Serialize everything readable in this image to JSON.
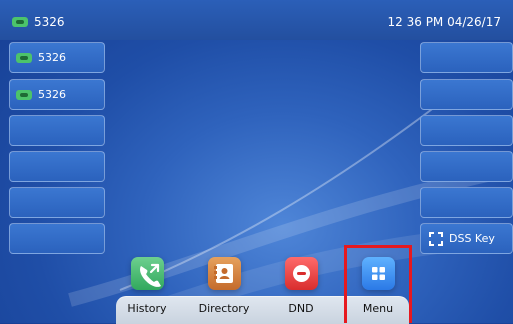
{
  "status": {
    "account": "5326",
    "datetime": "12 36 PM 04/26/17"
  },
  "left_keys": [
    {
      "label": "5326"
    },
    {
      "label": "5326"
    },
    {
      "label": ""
    },
    {
      "label": ""
    },
    {
      "label": ""
    },
    {
      "label": ""
    }
  ],
  "right_keys": [
    {
      "label": ""
    },
    {
      "label": ""
    },
    {
      "label": ""
    },
    {
      "label": ""
    },
    {
      "label": ""
    },
    {
      "label": "DSS Key"
    }
  ],
  "dock": {
    "history": "History",
    "directory": "Directory",
    "dnd": "DND",
    "menu": "Menu"
  },
  "colors": {
    "highlight": "#e6191f",
    "history_tile": "#31a85d",
    "directory_tile": "#c46b2c",
    "dnd_tile": "#d92d2d",
    "menu_tile": "#2b79e6"
  },
  "icons": {
    "history": "phone-call-icon",
    "directory": "contacts-book-icon",
    "dnd": "do-not-disturb-icon",
    "menu": "grid-menu-icon",
    "dss": "expand-icon"
  }
}
